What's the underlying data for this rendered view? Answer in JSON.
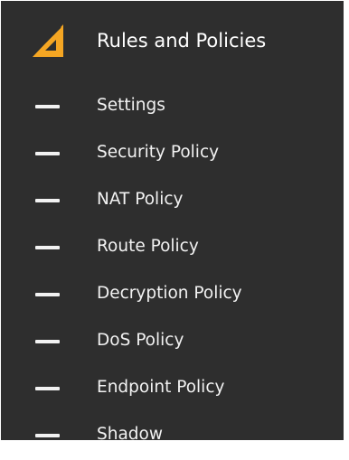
{
  "section": {
    "title": "Rules and Policies",
    "icon": "triangle-ruler-icon",
    "accent_color": "#f5a623"
  },
  "nav": {
    "items": [
      {
        "label": "Settings",
        "icon": "dash-icon"
      },
      {
        "label": "Security Policy",
        "icon": "dash-icon"
      },
      {
        "label": "NAT Policy",
        "icon": "dash-icon"
      },
      {
        "label": "Route Policy",
        "icon": "dash-icon"
      },
      {
        "label": "Decryption Policy",
        "icon": "dash-icon"
      },
      {
        "label": "DoS Policy",
        "icon": "dash-icon"
      },
      {
        "label": "Endpoint Policy",
        "icon": "dash-icon"
      },
      {
        "label": "Shadow",
        "icon": "dash-icon"
      }
    ]
  },
  "colors": {
    "background": "#2e2e2e",
    "text": "#f2f2f2"
  }
}
